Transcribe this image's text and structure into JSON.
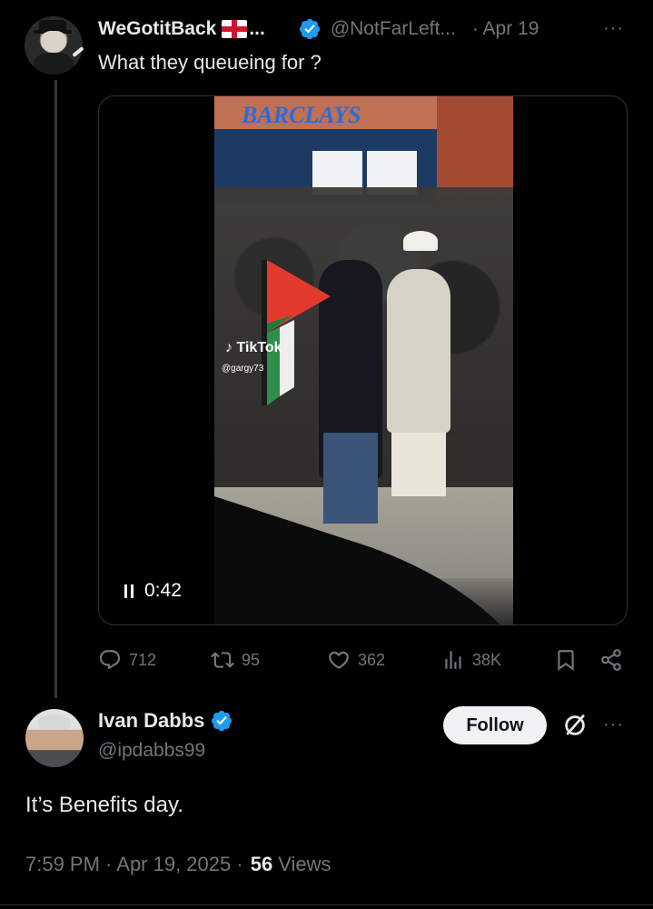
{
  "colors": {
    "background": "#000000",
    "text_primary": "#e7e9ea",
    "text_secondary": "#71767b",
    "verified_blue": "#1d9bf0",
    "follow_button_bg": "#eff3f4"
  },
  "parent_tweet": {
    "display_name": "WeGotitBack",
    "name_flag_icon": "england-flag-icon",
    "name_ellipsis": "...",
    "handle": "@NotFarLeft...",
    "date": "· Apr 19",
    "more_icon": "···",
    "text": "What they queueing for ?",
    "media": {
      "watermark_app": "TikTok",
      "watermark_handle": "@gargy73",
      "sign_text": "BARCLAYS",
      "state_icon": "pause-icon",
      "time": "0:42"
    },
    "actions": {
      "replies": "712",
      "reposts": "95",
      "likes": "362",
      "views": "38K"
    }
  },
  "reply_tweet": {
    "display_name": "Ivan Dabbs",
    "handle": "@ipdabbs99",
    "follow_label": "Follow",
    "more_icon": "···",
    "text": "It’s Benefits day.",
    "time": "7:59 PM · Apr 19, 2025 ·",
    "views_count": "56",
    "views_label": "Views"
  }
}
